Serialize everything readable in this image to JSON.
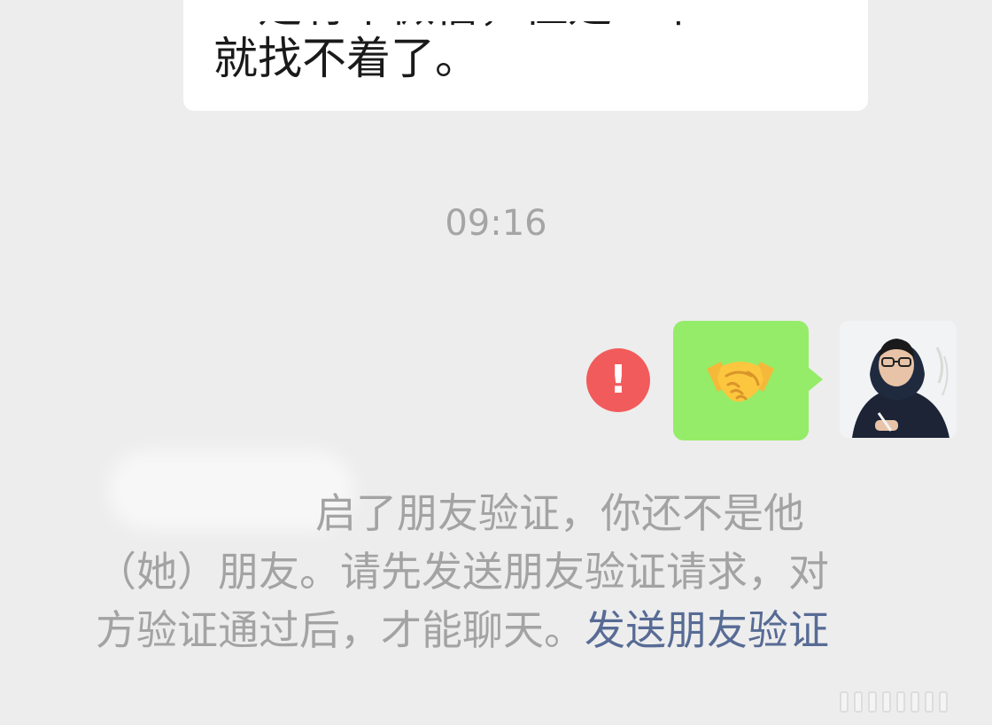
{
  "chat": {
    "incoming_message": {
      "cutoff_line": "一定有个微信，但是一平",
      "last_line": "就找不着了。"
    },
    "timestamp": "09:16",
    "outgoing_message": {
      "emoji_icon": "handshake-icon",
      "status": "failed",
      "fail_symbol": "!"
    },
    "avatar_icon": "user-avatar",
    "system_notice": {
      "line1": "启了朋友验证，你还不是他",
      "line2": "（她）朋友。请先发送朋友验证请求，对",
      "line3": "方验证通过后，才能聊天。",
      "link": "发送朋友验证"
    }
  },
  "colors": {
    "background": "#ededed",
    "incoming_bubble": "#ffffff",
    "outgoing_bubble": "#95ec69",
    "fail_red": "#f25b5b",
    "link_blue": "#576b95",
    "system_text": "#a3a3a3"
  }
}
